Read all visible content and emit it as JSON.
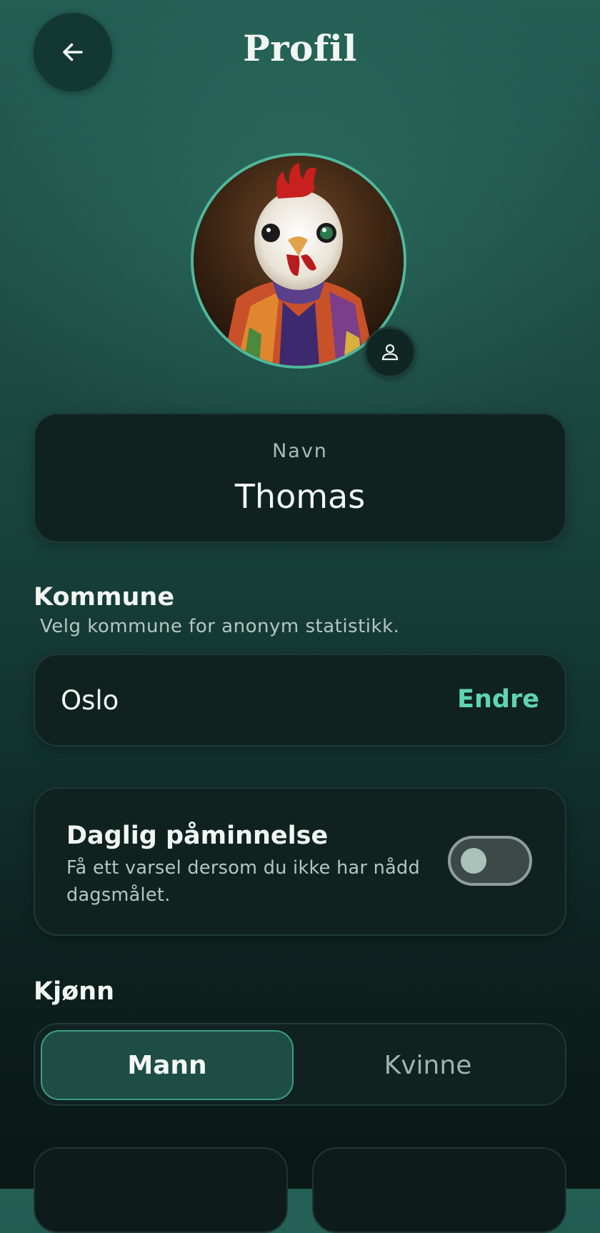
{
  "header": {
    "title": "Profil",
    "back_icon": "arrow-left-icon"
  },
  "avatar": {
    "description_icon": "rooster-portrait",
    "edit_icon": "person-icon"
  },
  "name_card": {
    "label": "Navn",
    "value": "Thomas"
  },
  "kommune": {
    "title": "Kommune",
    "subtitle": "Velg kommune for anonym statistikk.",
    "value": "Oslo",
    "edit_label": "Endre"
  },
  "reminder": {
    "title": "Daglig påminnelse",
    "description": "Få ett varsel dersom du ikke har nådd dagsmålet.",
    "enabled": false
  },
  "gender": {
    "title": "Kjønn",
    "options": [
      "Mann",
      "Kvinne"
    ],
    "selected": "Mann"
  },
  "colors": {
    "accent": "#5fd4b0",
    "card_bg": "#0f2220",
    "selected_bg": "#1d4d45"
  }
}
